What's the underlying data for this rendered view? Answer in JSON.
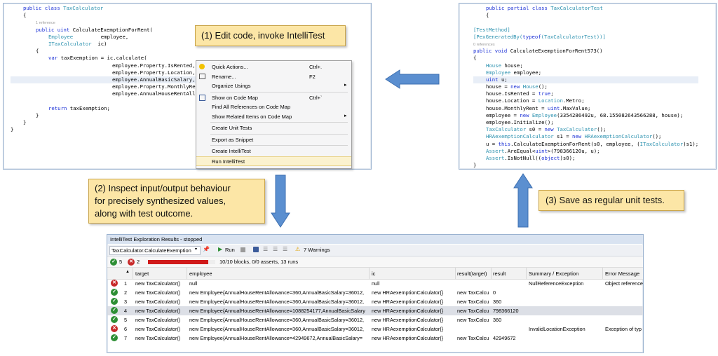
{
  "editor_left": {
    "lines": [
      {
        "indent": 1,
        "tokens": [
          {
            "t": "public class ",
            "c": "kw"
          },
          {
            "t": "TaxCalculator",
            "c": "ty"
          }
        ]
      },
      {
        "indent": 1,
        "tokens": [
          {
            "t": "{",
            "c": ""
          }
        ]
      },
      {
        "indent": 2,
        "tokens": [
          {
            "t": "1 reference",
            "c": "cm"
          }
        ]
      },
      {
        "indent": 2,
        "tokens": [
          {
            "t": "public uint ",
            "c": "kw"
          },
          {
            "t": "CalculateExemptionForRent(",
            "c": ""
          }
        ]
      },
      {
        "indent": 3,
        "tokens": [
          {
            "t": "Employee",
            "c": "ty"
          },
          {
            "t": "         employee,",
            "c": ""
          }
        ]
      },
      {
        "indent": 3,
        "tokens": [
          {
            "t": "ITaxCalculator",
            "c": "ty"
          },
          {
            "t": "  ic)",
            "c": ""
          }
        ]
      },
      {
        "indent": 2,
        "tokens": [
          {
            "t": "{",
            "c": ""
          }
        ]
      },
      {
        "indent": 3,
        "tokens": [
          {
            "t": "var ",
            "c": "kw"
          },
          {
            "t": "taxExemption = ic.calculate(",
            "c": ""
          }
        ]
      },
      {
        "indent": 0,
        "tokens": [
          {
            "t": "                                 employee.Property.IsRented,",
            "c": ""
          }
        ]
      },
      {
        "indent": 0,
        "tokens": [
          {
            "t": "                                 employee.Property.Location,",
            "c": ""
          }
        ]
      },
      {
        "indent": 0,
        "tokens": [
          {
            "t": "                                 employee.AnnualBasicSalary,",
            "c": ""
          }
        ]
      },
      {
        "indent": 0,
        "tokens": [
          {
            "t": "                                 employee.Property.MonthlyRent,",
            "c": ""
          }
        ]
      },
      {
        "indent": 0,
        "tokens": [
          {
            "t": "                                 employee.AnnualHouseRentAllowance);",
            "c": ""
          }
        ]
      },
      {
        "indent": 0,
        "tokens": [
          {
            "t": "",
            "c": ""
          }
        ]
      },
      {
        "indent": 3,
        "tokens": [
          {
            "t": "return ",
            "c": "kw"
          },
          {
            "t": "taxExemption;",
            "c": ""
          }
        ]
      },
      {
        "indent": 2,
        "tokens": [
          {
            "t": "}",
            "c": ""
          }
        ]
      },
      {
        "indent": 1,
        "tokens": [
          {
            "t": "}",
            "c": ""
          }
        ]
      },
      {
        "indent": 0,
        "tokens": [
          {
            "t": "}",
            "c": ""
          }
        ]
      }
    ]
  },
  "context_menu": {
    "items": [
      {
        "label": "Quick Actions...",
        "shortcut": "Ctrl+.",
        "icon": "lightbulb-icon",
        "submenu": false
      },
      {
        "label": "Rename...",
        "shortcut": "F2",
        "icon": "rename-icon",
        "submenu": false
      },
      {
        "label": "Organize Usings",
        "shortcut": "",
        "icon": "",
        "submenu": true
      },
      {
        "sep": true
      },
      {
        "label": "Show on Code Map",
        "shortcut": "Ctrl+`",
        "icon": "code-map-icon",
        "submenu": false
      },
      {
        "label": "Find All References on Code Map",
        "shortcut": "",
        "icon": "",
        "submenu": false
      },
      {
        "label": "Show Related Items on Code Map",
        "shortcut": "",
        "icon": "",
        "submenu": true
      },
      {
        "sep": true
      },
      {
        "label": "Create Unit Tests",
        "shortcut": "",
        "icon": "",
        "submenu": false
      },
      {
        "sep": true
      },
      {
        "label": "Export as Snippet",
        "shortcut": "",
        "icon": "",
        "submenu": false
      },
      {
        "sep": true
      },
      {
        "label": "Create IntelliTest",
        "shortcut": "",
        "icon": "",
        "submenu": false
      },
      {
        "label": "Run IntelliTest",
        "shortcut": "",
        "icon": "",
        "submenu": false,
        "highlighted": true
      }
    ]
  },
  "callouts": {
    "step1": "(1) Edit code, invoke IntelliTest",
    "step2_lines": [
      "(2) Inspect input/output behaviour",
      "for precisely synthesized values,",
      "along with test outcome."
    ],
    "step3": "(3) Save as regular unit tests."
  },
  "editor_right": {
    "lines": [
      {
        "indent": 1,
        "tokens": [
          {
            "t": "public partial class ",
            "c": "kw"
          },
          {
            "t": "TaxCalculatorTest",
            "c": "ty"
          }
        ]
      },
      {
        "indent": 1,
        "tokens": [
          {
            "t": "{",
            "c": ""
          }
        ]
      },
      {
        "indent": 0,
        "tokens": [
          {
            "t": "",
            "c": ""
          }
        ]
      },
      {
        "indent": 0,
        "tokens": [
          {
            "t": "[TestMethod]",
            "c": "at"
          }
        ]
      },
      {
        "indent": 0,
        "tokens": [
          {
            "t": "[PexGeneratedBy(",
            "c": "at"
          },
          {
            "t": "typeof",
            "c": "kw"
          },
          {
            "t": "(TaxCalculatorTest))]",
            "c": "at"
          }
        ]
      },
      {
        "indent": 0,
        "tokens": [
          {
            "t": "0 references",
            "c": "cm"
          }
        ]
      },
      {
        "indent": 0,
        "tokens": [
          {
            "t": "public void ",
            "c": "kw"
          },
          {
            "t": "CalculateExemptionForRent573()",
            "c": ""
          }
        ]
      },
      {
        "indent": 0,
        "tokens": [
          {
            "t": "{",
            "c": ""
          }
        ]
      },
      {
        "indent": 1,
        "tokens": [
          {
            "t": "House",
            "c": "ty"
          },
          {
            "t": " house;",
            "c": ""
          }
        ]
      },
      {
        "indent": 1,
        "tokens": [
          {
            "t": "Employee",
            "c": "ty"
          },
          {
            "t": " employee;",
            "c": ""
          }
        ]
      },
      {
        "indent": 1,
        "tokens": [
          {
            "t": "uint ",
            "c": "kw"
          },
          {
            "t": "u;",
            "c": ""
          }
        ]
      },
      {
        "indent": 1,
        "tokens": [
          {
            "t": "house = ",
            "c": ""
          },
          {
            "t": "new ",
            "c": "kw"
          },
          {
            "t": "House",
            "c": "ty"
          },
          {
            "t": "();",
            "c": ""
          }
        ]
      },
      {
        "indent": 1,
        "tokens": [
          {
            "t": "house.IsRented = ",
            "c": ""
          },
          {
            "t": "true",
            "c": "kw"
          },
          {
            "t": ";",
            "c": ""
          }
        ]
      },
      {
        "indent": 1,
        "tokens": [
          {
            "t": "house.Location = ",
            "c": ""
          },
          {
            "t": "Location",
            "c": "ty"
          },
          {
            "t": ".Metro;",
            "c": ""
          }
        ]
      },
      {
        "indent": 1,
        "tokens": [
          {
            "t": "house.MonthlyRent = ",
            "c": ""
          },
          {
            "t": "uint",
            "c": "kw"
          },
          {
            "t": ".MaxValue;",
            "c": ""
          }
        ]
      },
      {
        "indent": 1,
        "tokens": [
          {
            "t": "employee = ",
            "c": ""
          },
          {
            "t": "new ",
            "c": "kw"
          },
          {
            "t": "Employee",
            "c": "ty"
          },
          {
            "t": "(3354286492u, 68.155082643566288, house);",
            "c": ""
          }
        ]
      },
      {
        "indent": 1,
        "tokens": [
          {
            "t": "employee.Initialize();",
            "c": ""
          }
        ]
      },
      {
        "indent": 1,
        "tokens": [
          {
            "t": "TaxCalculator",
            "c": "ty"
          },
          {
            "t": " s0 = ",
            "c": ""
          },
          {
            "t": "new ",
            "c": "kw"
          },
          {
            "t": "TaxCalculator",
            "c": "ty"
          },
          {
            "t": "();",
            "c": ""
          }
        ]
      },
      {
        "indent": 1,
        "tokens": [
          {
            "t": "HRAexemptionCalculator",
            "c": "ty"
          },
          {
            "t": " s1 = ",
            "c": ""
          },
          {
            "t": "new ",
            "c": "kw"
          },
          {
            "t": "HRAexemptionCalculator",
            "c": "ty"
          },
          {
            "t": "();",
            "c": ""
          }
        ]
      },
      {
        "indent": 1,
        "tokens": [
          {
            "t": "u = ",
            "c": ""
          },
          {
            "t": "this",
            "c": "kw"
          },
          {
            "t": ".CalculateExemptionForRent(s0, employee, (",
            "c": ""
          },
          {
            "t": "ITaxCalculator",
            "c": "ty"
          },
          {
            "t": ")s1);",
            "c": ""
          }
        ]
      },
      {
        "indent": 1,
        "tokens": [
          {
            "t": "Assert",
            "c": "ty"
          },
          {
            "t": ".AreEqual<",
            "c": ""
          },
          {
            "t": "uint",
            "c": "kw"
          },
          {
            "t": ">(798366120u, u);",
            "c": ""
          }
        ]
      },
      {
        "indent": 1,
        "tokens": [
          {
            "t": "Assert",
            "c": "ty"
          },
          {
            "t": ".IsNotNull((",
            "c": ""
          },
          {
            "t": "object",
            "c": "kw"
          },
          {
            "t": ")s0);",
            "c": ""
          }
        ]
      },
      {
        "indent": 0,
        "tokens": [
          {
            "t": "}",
            "c": ""
          }
        ]
      }
    ]
  },
  "results": {
    "title": "IntelliTest Exploration Results - stopped",
    "method_dropdown": "TaxCalculator.CalculateExemption",
    "run_label": "Run",
    "warnings": "7 Warnings",
    "pass_count": "5",
    "fail_count": "2",
    "progress_fraction": 0.9,
    "progress_text": "10/10 blocks, 0/0 asserts, 13 runs",
    "columns": [
      "target",
      "employee",
      "ic",
      "result(target)",
      "result",
      "Summary / Exception",
      "Error Message"
    ],
    "rows": [
      {
        "status": "fail",
        "n": "1",
        "target": "new TaxCalculator()",
        "employee": "null",
        "ic": "null",
        "result_target": "",
        "result": "",
        "summary": "NullReferenceException",
        "error": "Object reference"
      },
      {
        "status": "pass",
        "n": "2",
        "target": "new TaxCalculator()",
        "employee": "new Employee{AnnualHouseRentAllowance=360,AnnualBasicSalary=36012,",
        "ic": "new HRAexemptionCalculator{}",
        "result_target": "new TaxCalcu",
        "result": "0",
        "summary": "",
        "error": ""
      },
      {
        "status": "pass",
        "n": "3",
        "target": "new TaxCalculator()",
        "employee": "new Employee{AnnualHouseRentAllowance=360,AnnualBasicSalary=36012,",
        "ic": "new HRAexemptionCalculator{}",
        "result_target": "new TaxCalcu",
        "result": "360",
        "summary": "",
        "error": ""
      },
      {
        "status": "pass",
        "n": "4",
        "target": "new TaxCalculator()",
        "employee": "new Employee{AnnualHouseRentAllowance=1088254177,AnnualBasicSalary",
        "ic": "new HRAexemptionCalculator{}",
        "result_target": "new TaxCalcu",
        "result": "798366120",
        "summary": "",
        "error": "",
        "selected": true
      },
      {
        "status": "pass",
        "n": "5",
        "target": "new TaxCalculator()",
        "employee": "new Employee{AnnualHouseRentAllowance=360,AnnualBasicSalary=36012,",
        "ic": "new HRAexemptionCalculator{}",
        "result_target": "new TaxCalcu",
        "result": "360",
        "summary": "",
        "error": ""
      },
      {
        "status": "fail",
        "n": "6",
        "target": "new TaxCalculator()",
        "employee": "new Employee{AnnualHouseRentAllowance=360,AnnualBasicSalary=36012,",
        "ic": "new HRAexemptionCalculator{}",
        "result_target": "",
        "result": "",
        "summary": "InvalidLocationException",
        "error": "Exception of typ"
      },
      {
        "status": "pass",
        "n": "7",
        "target": "new TaxCalculator()",
        "employee": "new Employee{AnnualHouseRentAllowance=42949672,AnnualBasicSalary=",
        "ic": "new HRAexemptionCalculator{}",
        "result_target": "new TaxCalcu",
        "result": "42949672",
        "summary": "",
        "error": ""
      }
    ]
  },
  "colors": {
    "callout_bg": "#fce6a6",
    "arrow": "#5b8fd0",
    "pass": "#2e8f35",
    "fail": "#c82a2a",
    "progress": "#d01a1a"
  }
}
